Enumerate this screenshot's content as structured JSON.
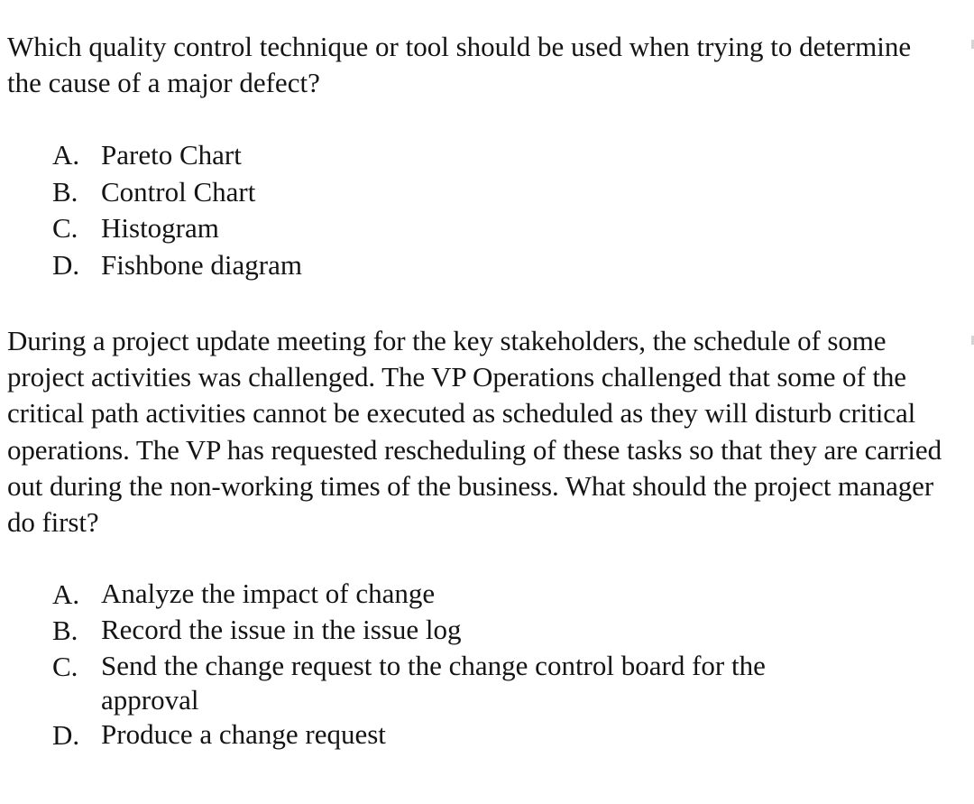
{
  "questions": [
    {
      "stem": "Which quality control technique or tool should be used when trying to determine the cause of a major defect?",
      "options": [
        {
          "letter": "A.",
          "text": "Pareto Chart"
        },
        {
          "letter": "B.",
          "text": "Control Chart"
        },
        {
          "letter": "C.",
          "text": "Histogram"
        },
        {
          "letter": "D.",
          "text": "Fishbone diagram"
        }
      ]
    },
    {
      "stem": "During a project update meeting for the key stakeholders, the schedule of some project activities was challenged. The VP Operations challenged that some of the critical path activities cannot be executed as scheduled as they will disturb critical operations. The VP has requested rescheduling of these tasks so that they are carried out during the non-working times of the business. What should the project manager do first?",
      "options": [
        {
          "letter": "A.",
          "text": "Analyze the impact of change"
        },
        {
          "letter": "B.",
          "text": "Record the issue in the issue log"
        },
        {
          "letter": "C.",
          "text": "Send the change request to the change control board for the approval"
        },
        {
          "letter": "D.",
          "text": "Produce a change request"
        }
      ]
    }
  ]
}
